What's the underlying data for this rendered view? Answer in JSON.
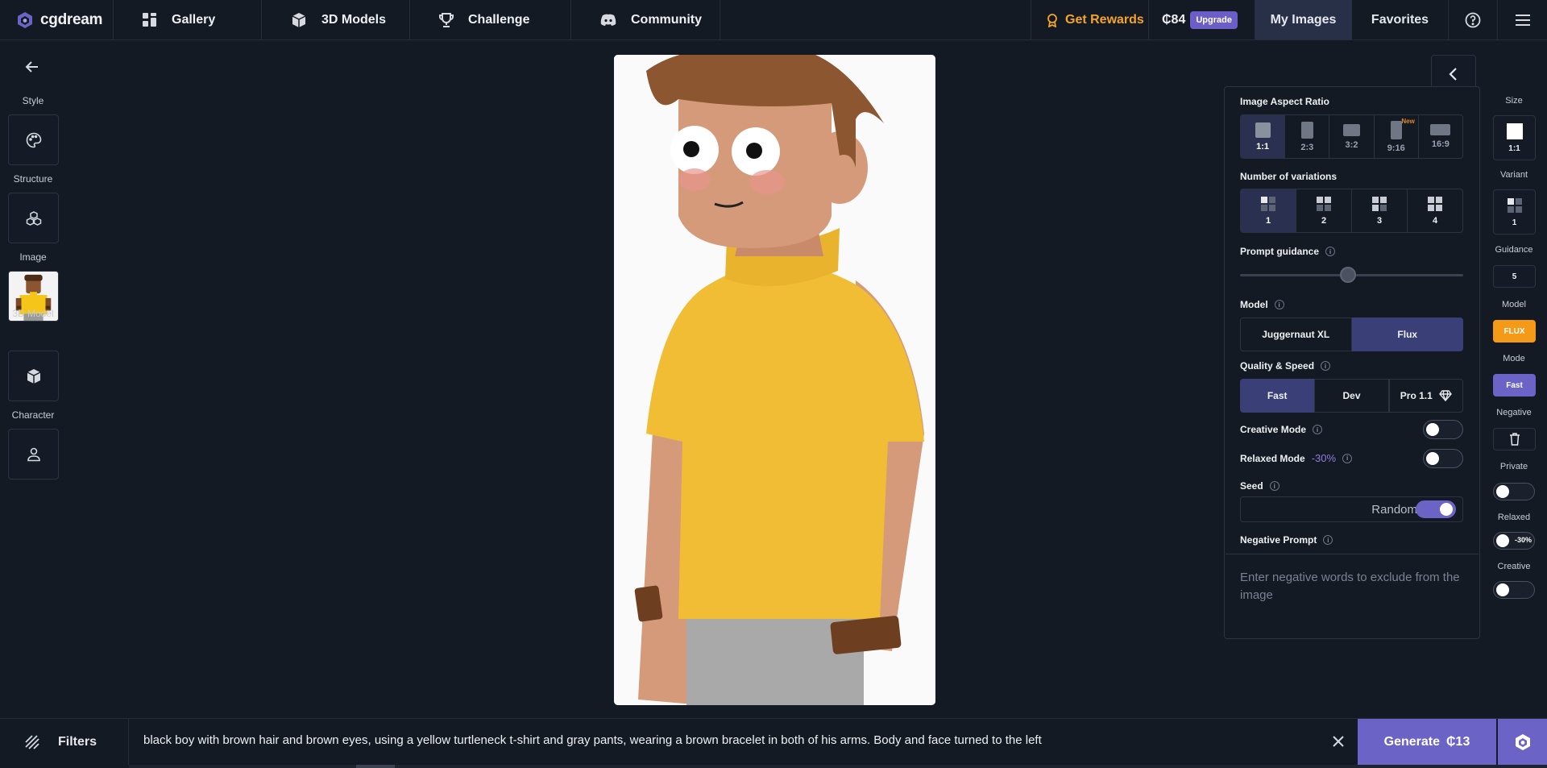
{
  "app": {
    "name": "cgdream"
  },
  "nav": {
    "gallery": "Gallery",
    "models3d": "3D Models",
    "challenge": "Challenge",
    "community": "Community",
    "rewards": "Get Rewards",
    "credits": "₵84",
    "upgrade": "Upgrade",
    "my_images": "My Images",
    "favorites": "Favorites"
  },
  "sidebar": {
    "style": "Style",
    "structure": "Structure",
    "image": "Image",
    "model3d": "3D Model",
    "character": "Character"
  },
  "panel": {
    "aspect_title": "Image Aspect Ratio",
    "aspect_options": [
      "1:1",
      "2:3",
      "3:2",
      "9:16",
      "16:9"
    ],
    "aspect_selected": "1:1",
    "new_tag": "New",
    "variations_title": "Number of variations",
    "variation_options": [
      "1",
      "2",
      "3",
      "4"
    ],
    "variations_selected": "1",
    "guidance_title": "Prompt guidance",
    "guidance_value": 5,
    "guidance_min": 1,
    "guidance_max": 10,
    "model_title": "Model",
    "model_options": [
      "Juggernaut XL",
      "Flux"
    ],
    "model_selected": "Flux",
    "quality_title": "Quality & Speed",
    "quality_options": [
      "Fast",
      "Dev",
      "Pro 1.1"
    ],
    "quality_selected": "Fast",
    "creative_title": "Creative Mode",
    "creative_on": false,
    "relaxed_title": "Relaxed Mode",
    "relaxed_pct": "-30%",
    "relaxed_on": false,
    "seed_title": "Seed",
    "seed_text": "Random",
    "seed_random_on": true,
    "negative_title": "Negative Prompt",
    "negative_placeholder": "Enter negative words to exclude from the image"
  },
  "minibar": {
    "size_label": "Size",
    "size_value": "1:1",
    "variant_label": "Variant",
    "variant_value": "1",
    "guidance_label": "Guidance",
    "guidance_value": "5",
    "model_label": "Model",
    "model_value": "FLUX",
    "mode_label": "Mode",
    "mode_value": "Fast",
    "negative_label": "Negative",
    "private_label": "Private",
    "relaxed_label": "Relaxed",
    "relaxed_pct": "-30%",
    "creative_label": "Creative"
  },
  "bottom": {
    "filters": "Filters",
    "prompt": "black boy with brown hair and brown eyes, using a yellow turtleneck t-shirt and gray pants, wearing a brown bracelet in both of his arms. Body and face turned to the left",
    "generate": "Generate",
    "generate_cost": "₵13"
  },
  "colors": {
    "background": "#141a24",
    "accent": "#6b63c6",
    "rewards": "#f5a524",
    "flux": "#f59a16"
  }
}
